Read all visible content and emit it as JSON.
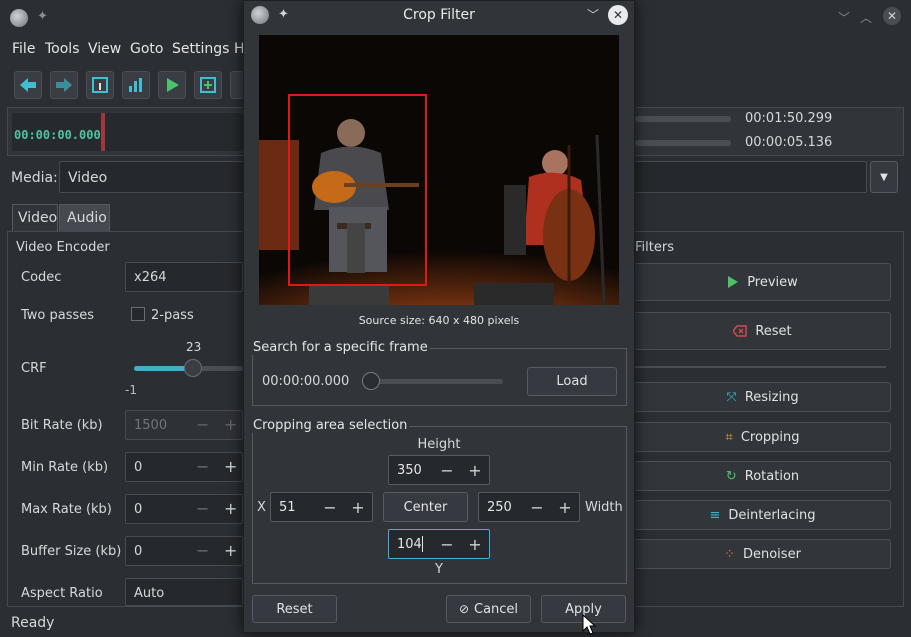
{
  "main": {
    "menu": [
      "File",
      "Tools",
      "View",
      "Goto",
      "Settings",
      "H"
    ],
    "timeline": {
      "current_time": "00:00:00.000",
      "end_time": "00:01:50.299",
      "selection_time": "00:00:05.136"
    },
    "media": {
      "label": "Media:",
      "value": "Video"
    },
    "tabs": [
      "Video",
      "Audio"
    ],
    "encoder": {
      "title": "Video Encoder",
      "rows": [
        {
          "label": "Codec",
          "value": "x264"
        },
        {
          "label": "Two passes",
          "value": "2-pass"
        },
        {
          "label": "CRF",
          "value": "23",
          "min": "-1"
        },
        {
          "label": "Bit Rate (kb)",
          "value": "1500"
        },
        {
          "label": "Min Rate (kb)",
          "value": "0"
        },
        {
          "label": "Max Rate (kb)",
          "value": "0"
        },
        {
          "label": "Buffer Size (kb)",
          "value": "0"
        },
        {
          "label": "Aspect Ratio",
          "value": "Auto"
        }
      ]
    },
    "filters": {
      "title": "Filters",
      "preview": "Preview",
      "reset": "Reset",
      "items": [
        "Resizing",
        "Cropping",
        "Rotation",
        "Deinterlacing",
        "Denoiser"
      ]
    },
    "status": "Ready"
  },
  "dialog": {
    "title": "Crop Filter",
    "source_size": "Source size: 640 x 480 pixels",
    "search": {
      "title": "Search for a specific frame",
      "time": "00:00:00.000",
      "load": "Load"
    },
    "crop": {
      "title": "Cropping area selection",
      "height_label": "Height",
      "height": "350",
      "x_label": "X",
      "x": "51",
      "center": "Center",
      "width": "250",
      "width_label": "Width",
      "y": "104",
      "y_label": "Y"
    },
    "buttons": {
      "reset": "Reset",
      "cancel": "Cancel",
      "apply": "Apply"
    }
  }
}
